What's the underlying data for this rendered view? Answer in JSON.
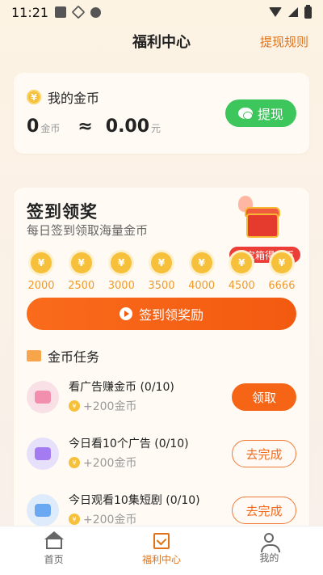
{
  "status_bar": {
    "time": "11:21"
  },
  "header": {
    "title": "福利中心",
    "rules_link": "提现规则"
  },
  "coins": {
    "title": "我的金币",
    "coin_glyph": "¥",
    "count": "0",
    "count_unit": "金币",
    "approx": "≈",
    "money": "0.00",
    "money_unit": "元",
    "withdraw_label": "提现"
  },
  "signin": {
    "title": "签到领奖",
    "subtitle": "每日签到领取海量金币",
    "chest_badge": "开宝箱得金币",
    "days": [
      "2000",
      "2500",
      "3000",
      "3500",
      "4000",
      "4500",
      "6666"
    ],
    "button_label": "签到领奖励"
  },
  "tasks": {
    "heading": "金币任务",
    "items": [
      {
        "name": "看广告赚金币 (0/10)",
        "reward": "+200金币",
        "button": "领取",
        "icon": "heart-video-icon",
        "color": "#f9dfe6",
        "accent": "#f28fae"
      },
      {
        "name": "今日看10个广告 (0/10)",
        "reward": "+200金币",
        "button": "去完成",
        "icon": "ad-icon",
        "color": "#e7e0fb",
        "accent": "#a47bf0"
      },
      {
        "name": "今日观看10集短剧 (0/10)",
        "reward": "+200金币",
        "button": "去完成",
        "icon": "drama-icon",
        "color": "#ddebfb",
        "accent": "#6aa8f2"
      }
    ]
  },
  "nav": {
    "items": [
      {
        "label": "首页"
      },
      {
        "label": "福利中心"
      },
      {
        "label": "我的"
      }
    ]
  },
  "colors": {
    "accent": "#f66515",
    "green": "#3cc65b",
    "gold": "#f6c03a"
  }
}
